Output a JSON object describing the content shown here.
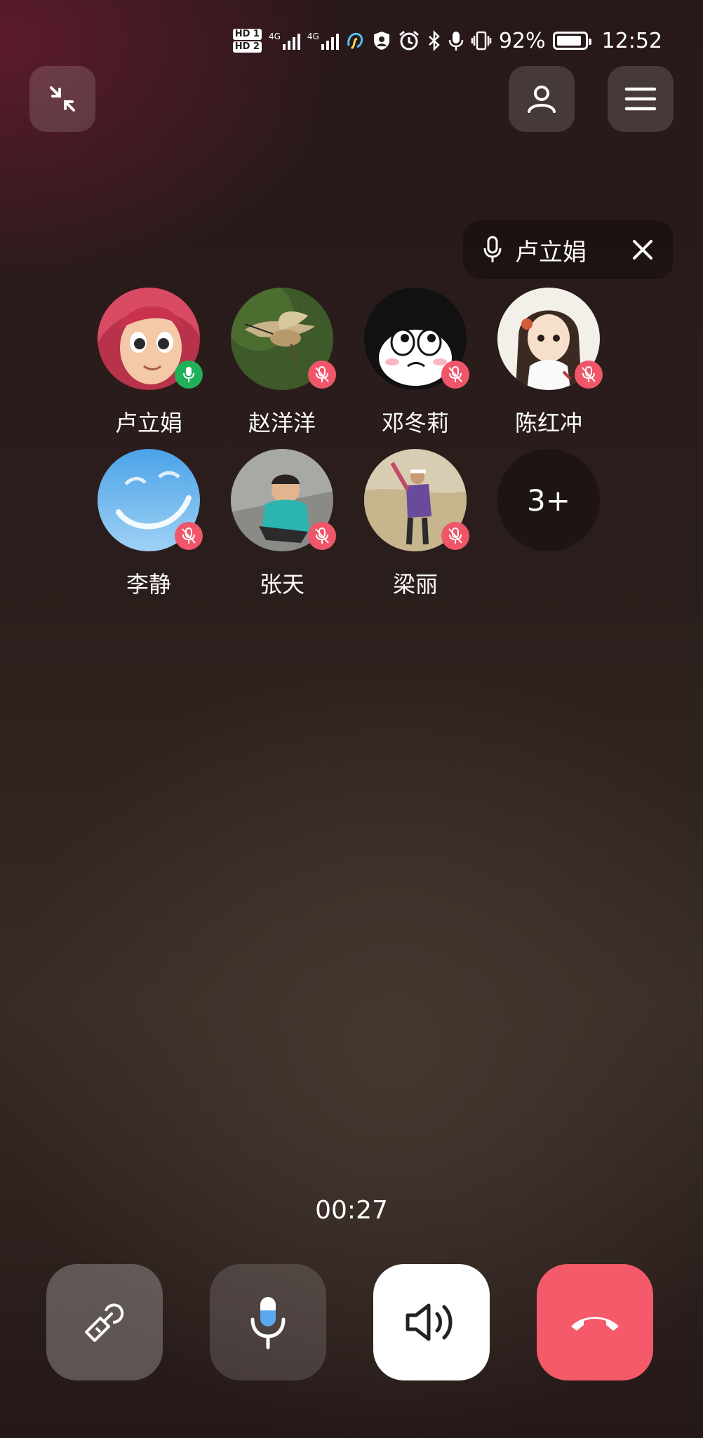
{
  "status_bar": {
    "hd1": "HD 1",
    "hd2": "HD 2",
    "net1": "4G",
    "net2": "4G",
    "battery_percent": "92%",
    "battery_level": 0.92,
    "time": "12:52"
  },
  "speaking_indicator": {
    "name": "卢立娟"
  },
  "participants": [
    {
      "name": "卢立娟",
      "mic": "on"
    },
    {
      "name": "赵洋洋",
      "mic": "muted"
    },
    {
      "name": "邓冬莉",
      "mic": "muted"
    },
    {
      "name": "陈红冲",
      "mic": "muted"
    },
    {
      "name": "李静",
      "mic": "muted"
    },
    {
      "name": "张天",
      "mic": "muted"
    },
    {
      "name": "梁丽",
      "mic": "muted"
    }
  ],
  "more_participants": "3+",
  "timer": "00:27",
  "colors": {
    "hangup": "#f45a69",
    "mic_on_badge": "#21b05a",
    "mic_muted_badge": "#f0566a"
  }
}
